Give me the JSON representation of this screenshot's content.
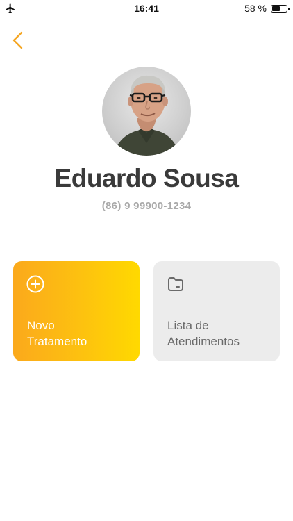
{
  "status_bar": {
    "time": "16:41",
    "battery_text": "58 %",
    "battery_level": 0.58,
    "airplane_icon": "airplane-icon"
  },
  "header": {
    "back_icon": "chevron-left-icon",
    "accent_color": "#f5a623"
  },
  "profile": {
    "name": "Eduardo Sousa",
    "phone": "(86) 9 99900-1234"
  },
  "actions": {
    "new_treatment": {
      "line1": "Novo",
      "line2": "Tratamento",
      "icon": "plus-circle-icon",
      "gradient_start": "#fba91c",
      "gradient_end": "#ffd900"
    },
    "appointments_list": {
      "line1": "Lista de",
      "line2": "Atendimentos",
      "icon": "folder-icon",
      "background": "#ececec"
    }
  }
}
